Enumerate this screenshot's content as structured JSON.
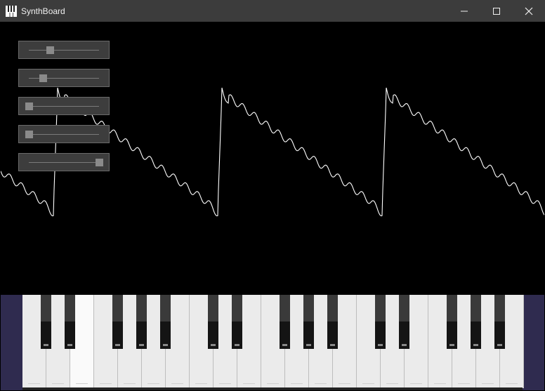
{
  "window": {
    "title": "SynthBoard",
    "icon": "piano-keys-icon",
    "controls": [
      "minimize-icon",
      "maximize-icon",
      "close-icon"
    ]
  },
  "colors": {
    "titlebar": "#3c3c3c",
    "canvas": "#000000",
    "waveform": "#ffffff",
    "keyboard_background": "#2f2b4f",
    "white_key": "#ebebeb",
    "black_key": "#141414"
  },
  "sliders": [
    {
      "id": "slider-1",
      "value": 0.3
    },
    {
      "id": "slider-2",
      "value": 0.2
    },
    {
      "id": "slider-3",
      "value": 0.0
    },
    {
      "id": "slider-4",
      "value": 0.0
    },
    {
      "id": "slider-5",
      "value": 1.0
    }
  ],
  "keyboard": {
    "white_key_count": 21,
    "pressed_white_key_index": 2
  },
  "waveform": {
    "type": "sawtooth",
    "cycles_visible": 3
  }
}
